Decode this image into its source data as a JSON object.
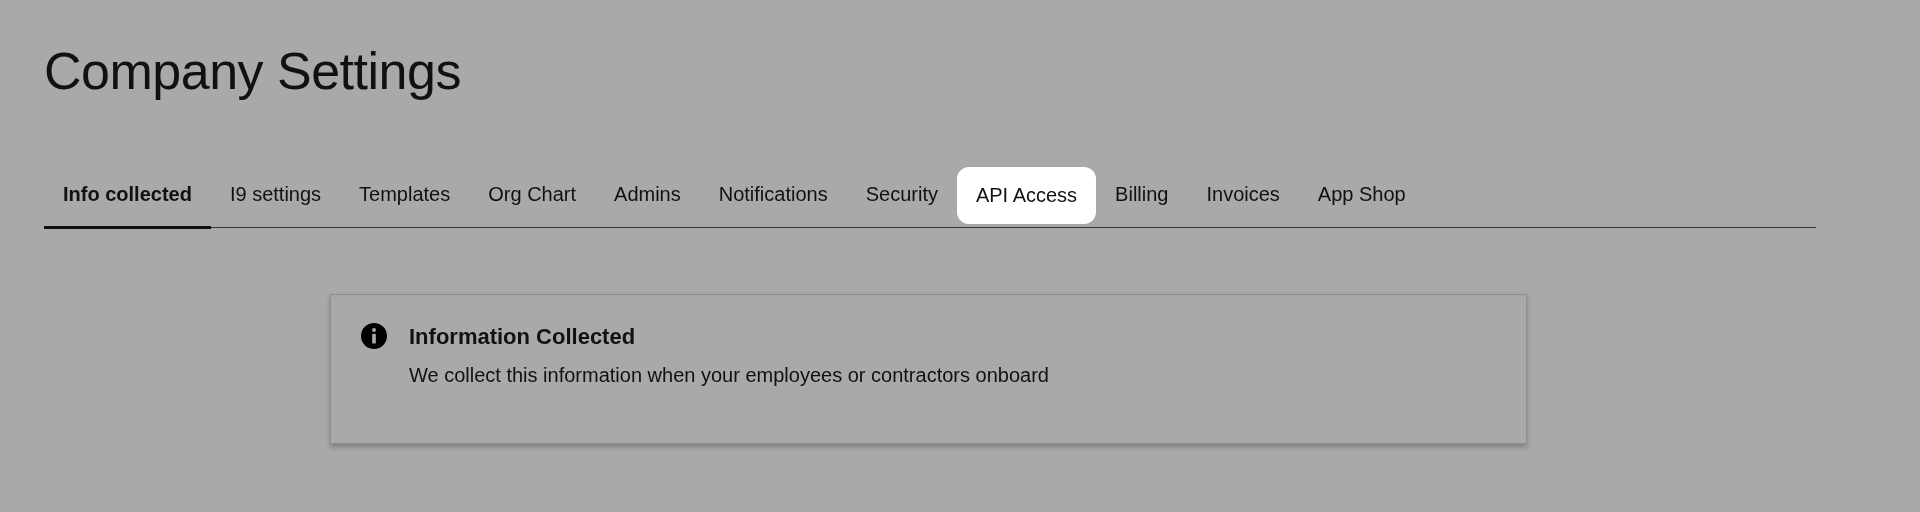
{
  "page": {
    "title": "Company Settings"
  },
  "tabs": [
    {
      "label": "Info collected",
      "selected": true,
      "highlighted": false
    },
    {
      "label": "I9 settings",
      "selected": false,
      "highlighted": false
    },
    {
      "label": "Templates",
      "selected": false,
      "highlighted": false
    },
    {
      "label": "Org Chart",
      "selected": false,
      "highlighted": false
    },
    {
      "label": "Admins",
      "selected": false,
      "highlighted": false
    },
    {
      "label": "Notifications",
      "selected": false,
      "highlighted": false
    },
    {
      "label": "Security",
      "selected": false,
      "highlighted": false
    },
    {
      "label": "API Access",
      "selected": false,
      "highlighted": true
    },
    {
      "label": "Billing",
      "selected": false,
      "highlighted": false
    },
    {
      "label": "Invoices",
      "selected": false,
      "highlighted": false
    },
    {
      "label": "App Shop",
      "selected": false,
      "highlighted": false
    }
  ],
  "notice": {
    "title": "Information Collected",
    "text": "We collect this information when your employees or contractors onboard"
  }
}
